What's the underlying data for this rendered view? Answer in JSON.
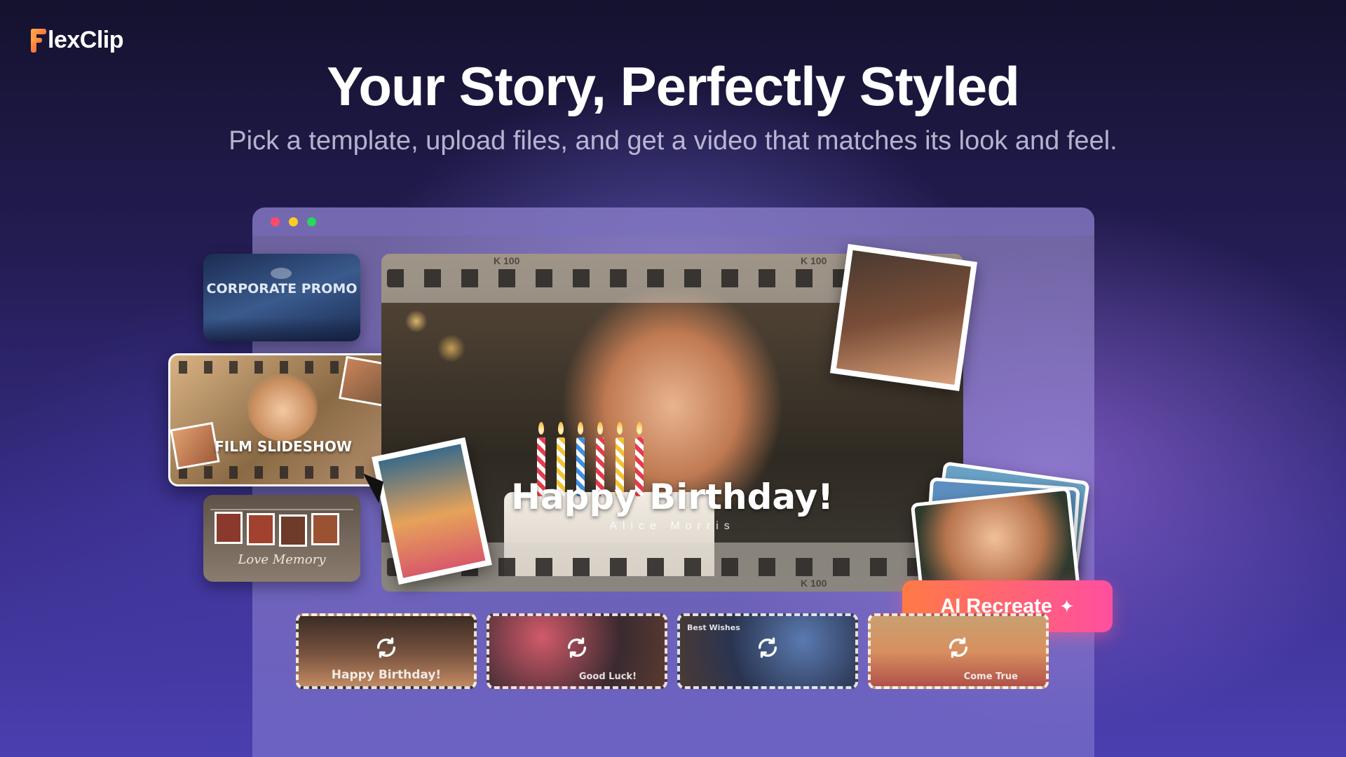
{
  "brand": {
    "name": "lexClip",
    "logo_letter": "F"
  },
  "hero": {
    "title": "Your Story, Perfectly Styled",
    "subtitle": "Pick a template, upload files, and get a video that matches its look and feel."
  },
  "window": {
    "dots": [
      "red",
      "yellow",
      "green"
    ]
  },
  "templates": [
    {
      "title": "CORPORATE PROMO"
    },
    {
      "title": "FILM SLIDESHOW"
    },
    {
      "title": "Love Memory"
    }
  ],
  "preview": {
    "film_mark": "K 100",
    "title": "Happy Birthday!",
    "name": "Alice Morris"
  },
  "ai_button": {
    "label": "AI Recreate",
    "icon": "sparkle-icon"
  },
  "variations": [
    {
      "caption": "Happy Birthday!"
    },
    {
      "caption": "Good Luck!"
    },
    {
      "caption": "Best Wishes"
    },
    {
      "caption": "Come True"
    }
  ],
  "colors": {
    "accent_start": "#ff7a45",
    "accent_end": "#ff4fa0",
    "brand_orange": "#ff8a3d"
  }
}
